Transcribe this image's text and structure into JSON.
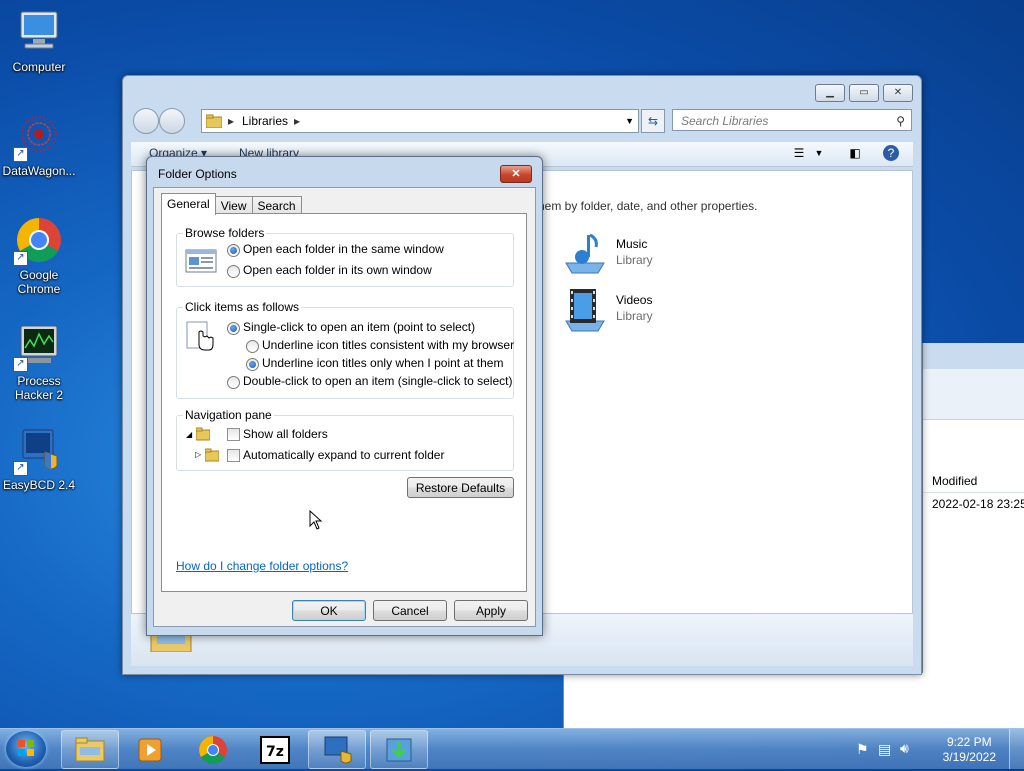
{
  "desktop": {
    "icons": [
      {
        "label": "Computer"
      },
      {
        "label": "DataWagon..."
      },
      {
        "label": "Google Chrome"
      },
      {
        "label": "Process Hacker 2"
      },
      {
        "label": "EasyBCD 2.4"
      }
    ]
  },
  "explorer": {
    "address": {
      "crumb": "Libraries"
    },
    "search_placeholder": "Search Libraries",
    "toolbar": {
      "organize": "Organize ▾",
      "new_library": "New library"
    },
    "description": "hem by folder, date, and other properties.",
    "libraries": [
      {
        "name": "Music",
        "type": "Library"
      },
      {
        "name": "Videos",
        "type": "Library"
      }
    ]
  },
  "right_window": {
    "column_header": "Modified",
    "cell": "2022-02-18 23:25"
  },
  "dialog": {
    "title": "Folder Options",
    "close_glyph": "✕",
    "tabs": [
      "General",
      "View",
      "Search"
    ],
    "active_tab": "General",
    "browse_folders": {
      "title": "Browse folders",
      "options": [
        "Open each folder in the same window",
        "Open each folder in its own window"
      ],
      "selected": 0
    },
    "click_items": {
      "title": "Click items as follows",
      "single_click": "Single-click to open an item (point to select)",
      "underline_browser": "Underline icon titles consistent with my browser",
      "underline_point": "Underline icon titles only when I point at them",
      "double_click": "Double-click to open an item (single-click to select)"
    },
    "navigation_pane": {
      "title": "Navigation pane",
      "show_all": "Show all folders",
      "auto_expand": "Automatically expand to current folder"
    },
    "restore_defaults": "Restore Defaults",
    "help_link": "How do I change folder options?",
    "buttons": {
      "ok": "OK",
      "cancel": "Cancel",
      "apply": "Apply"
    }
  },
  "taskbar": {
    "clock_time": "9:22 PM",
    "clock_date": "3/19/2022"
  },
  "colors": {
    "desktop": "#1567c4",
    "link": "#0066cc",
    "close_button": "#c8462d"
  }
}
